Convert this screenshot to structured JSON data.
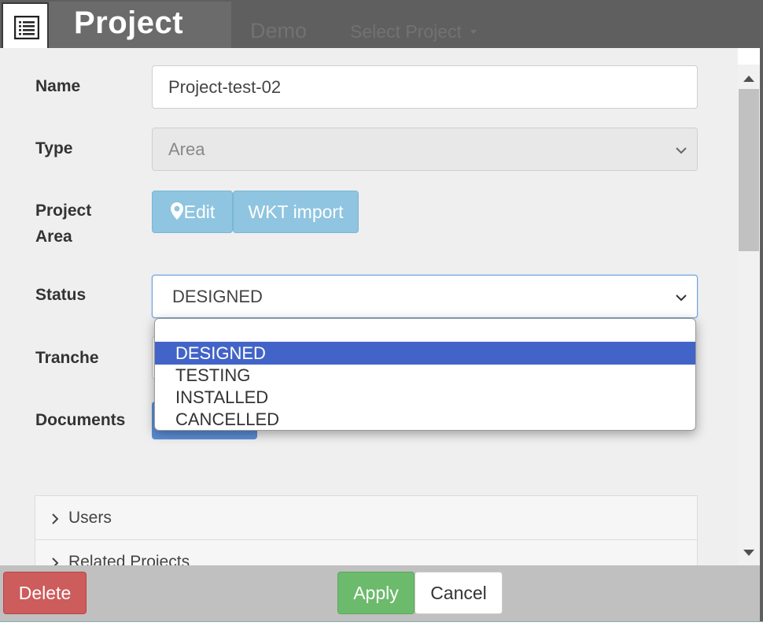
{
  "header": {
    "title": "Project",
    "background_nav": {
      "demo": "Demo",
      "select_project": "Select Project"
    },
    "menu_icon": "list-icon"
  },
  "form": {
    "name": {
      "label": "Name",
      "value": "Project-test-02"
    },
    "type": {
      "label": "Type",
      "value": "Area"
    },
    "project_area": {
      "label_line1": "Project",
      "label_line2": "Area",
      "edit_button": "Edit",
      "edit_icon": "map-marker-icon",
      "wkt_button": "WKT import"
    },
    "status": {
      "label": "Status",
      "value": "DESIGNED",
      "options": [
        "",
        "DESIGNED",
        "TESTING",
        "INSTALLED",
        "CANCELLED"
      ],
      "selected_index": 1
    },
    "tranche": {
      "label": "Tranche"
    },
    "documents": {
      "label": "Documents"
    }
  },
  "accordion": [
    {
      "label": "Users"
    },
    {
      "label": "Related Projects"
    }
  ],
  "footer": {
    "delete": "Delete",
    "apply": "Apply",
    "cancel": "Cancel"
  },
  "colors": {
    "header_bg": "#5f5f5f",
    "body_bg": "#efefef",
    "info_button": "#8fc5e0",
    "selected_option": "#4264c8",
    "delete": "#cd5c5c",
    "apply": "#6cba6c"
  }
}
